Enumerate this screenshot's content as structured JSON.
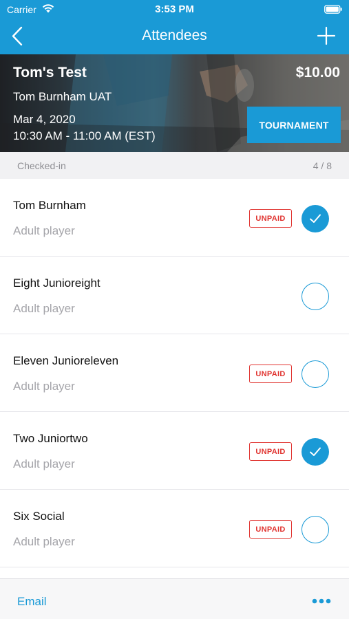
{
  "status_bar": {
    "carrier": "Carrier",
    "time": "3:53 PM"
  },
  "nav": {
    "title": "Attendees",
    "back_icon": "chevron-left-icon",
    "add_icon": "plus-icon"
  },
  "event": {
    "title": "Tom's Test",
    "price": "$10.00",
    "organizer": "Tom Burnham UAT",
    "date": "Mar 4, 2020",
    "time": "10:30 AM - 11:00 AM (EST)",
    "type_label": "TOURNAMENT"
  },
  "section": {
    "label": "Checked-in",
    "count": "4 / 8"
  },
  "attendees": [
    {
      "name": "Tom Burnham",
      "role": "Adult player",
      "badge": "UNPAID",
      "checked": true
    },
    {
      "name": "Eight Junioreight",
      "role": "Adult player",
      "badge": "",
      "checked": false
    },
    {
      "name": "Eleven Junioreleven",
      "role": "Adult player",
      "badge": "UNPAID",
      "checked": false
    },
    {
      "name": "Two Juniortwo",
      "role": "Adult player",
      "badge": "UNPAID",
      "checked": true
    },
    {
      "name": "Six Social",
      "role": "Adult player",
      "badge": "UNPAID",
      "checked": false
    }
  ],
  "toolbar": {
    "email_label": "Email",
    "more_icon": "more-dots-icon"
  },
  "colors": {
    "accent": "#1a9ad6",
    "unpaid": "#e0322e",
    "muted_text": "#a5a5aa",
    "section_bg": "#f1f1f3"
  }
}
